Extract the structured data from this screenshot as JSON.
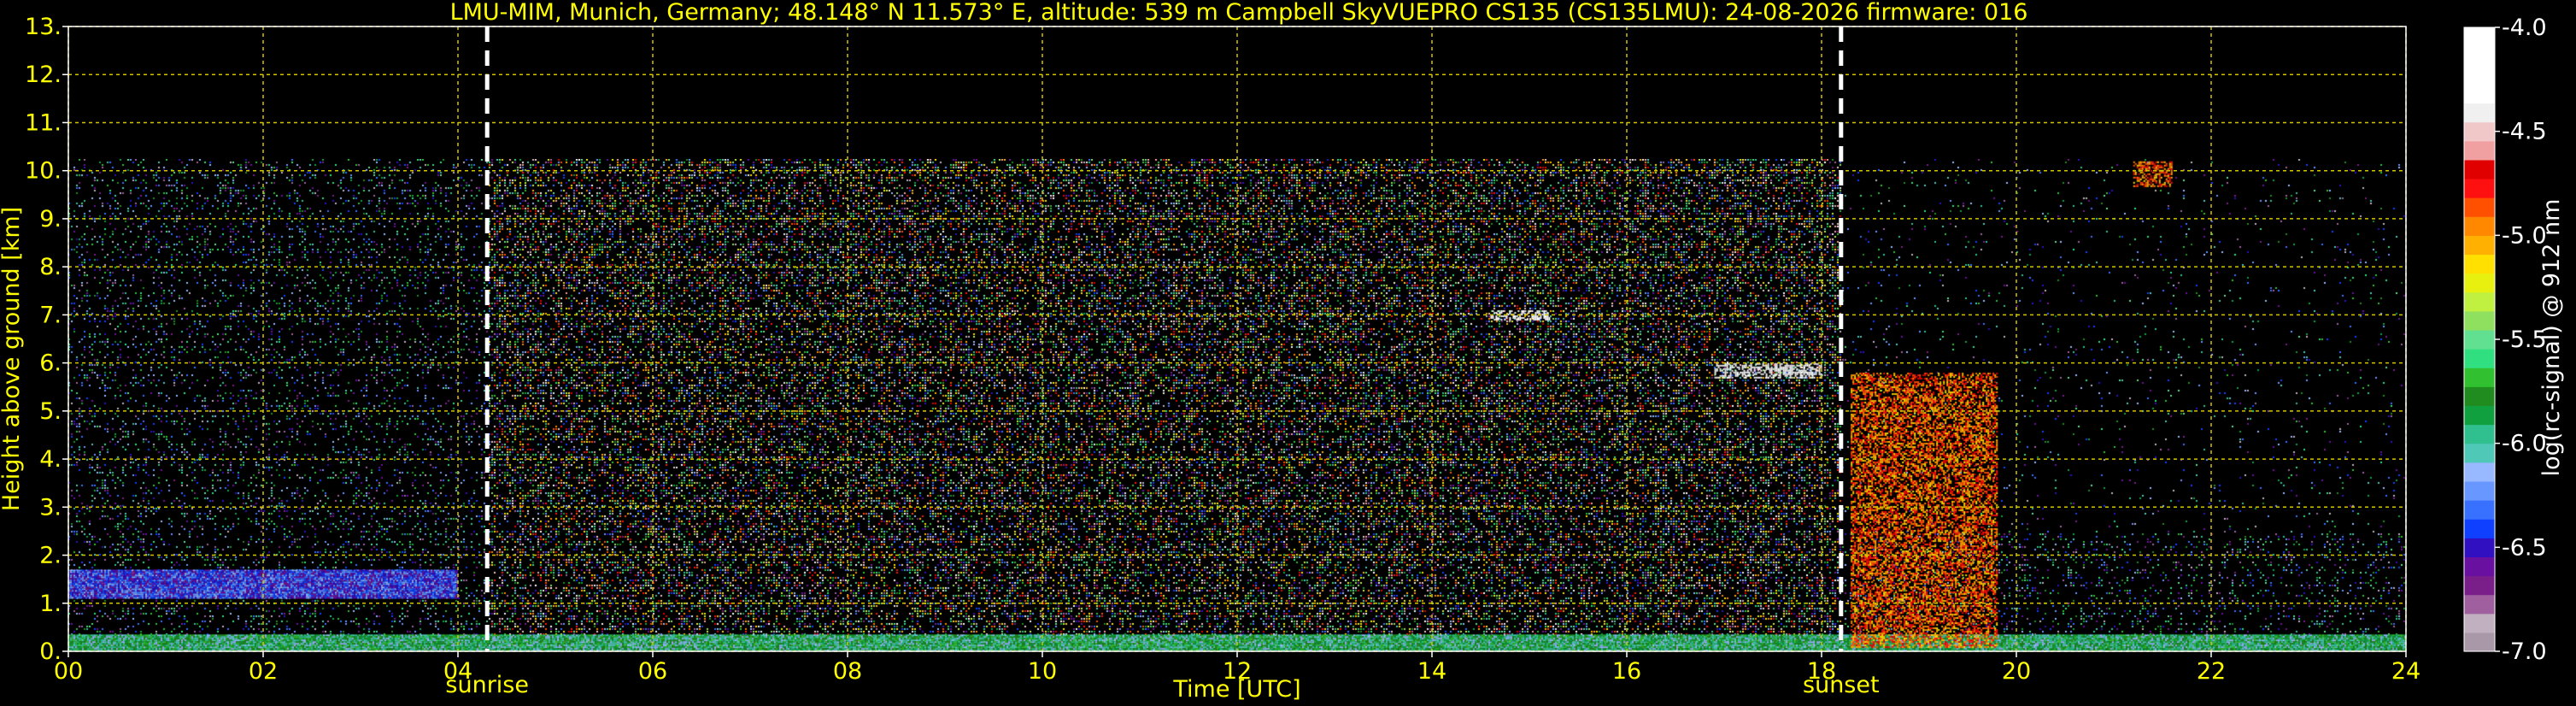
{
  "chart_data": {
    "type": "heatmap",
    "title": "LMU-MIM, Munich, Germany; 48.148° N 11.573° E, altitude: 539 m    Campbell SkyVUEPRO CS135 (CS135LMU): 24-08-2026    firmware: 016",
    "xlabel": "Time [UTC]",
    "ylabel": "Height above ground [km]",
    "xlim": [
      0,
      24
    ],
    "ylim": [
      0,
      13
    ],
    "x_ticks": [
      0,
      2,
      4,
      6,
      8,
      10,
      12,
      14,
      16,
      18,
      20,
      22,
      24
    ],
    "x_tick_labels": [
      "00",
      "02",
      "04",
      "06",
      "08",
      "10",
      "12",
      "14",
      "16",
      "18",
      "20",
      "22",
      "24"
    ],
    "y_ticks": [
      0,
      1,
      2,
      3,
      4,
      5,
      6,
      7,
      8,
      9,
      10,
      11,
      12,
      13
    ],
    "y_tick_labels": [
      "0.",
      "1.",
      "2.",
      "3.",
      "4.",
      "5.",
      "6.",
      "7.",
      "8.",
      "9.",
      "10.",
      "11.",
      "12.",
      "13."
    ],
    "grid": true,
    "data_top_km": 10.25,
    "events": [
      {
        "label": "sunrise",
        "time": 4.3
      },
      {
        "label": "sunset",
        "time": 18.2
      }
    ],
    "colorbar": {
      "label": "log(rc-signal) @ 912 nm",
      "range": [
        -7.0,
        -4.0
      ],
      "ticks": [
        -4.0,
        -4.5,
        -5.0,
        -5.5,
        -6.0,
        -6.5,
        -7.0
      ],
      "tick_labels": [
        "-4.0",
        "-4.5",
        "-5.0",
        "-5.5",
        "-6.0",
        "-6.5",
        "-7.0"
      ],
      "colors": [
        "#a898a8",
        "#c0b0c0",
        "#a060a0",
        "#7a1e8a",
        "#6a10a0",
        "#3010c0",
        "#1040ff",
        "#3870ff",
        "#6898ff",
        "#98b8ff",
        "#50c8b8",
        "#30c090",
        "#10a040",
        "#208c20",
        "#30c030",
        "#30e080",
        "#60e090",
        "#90e060",
        "#c0f040",
        "#e8f010",
        "#ffe000",
        "#ffb000",
        "#ff8800",
        "#ff5000",
        "#ff1010",
        "#e00000",
        "#f0a0a0",
        "#f0c8c8",
        "#f0f0f0",
        "#ffffff",
        "#ffffff",
        "#ffffff",
        "#ffffff"
      ]
    },
    "features": [
      {
        "kind": "aerosol_layer",
        "t0": 0,
        "t1": 4,
        "z0": 1.1,
        "z1": 1.7,
        "level": -6.4
      },
      {
        "kind": "boundary_layer",
        "t0": 0,
        "t1": 24,
        "z0": 0,
        "z1": 0.35,
        "level": -5.9
      },
      {
        "kind": "cloud",
        "t0": 14.6,
        "t1": 15.2,
        "z0": 6.9,
        "z1": 7.1,
        "level": -4.2
      },
      {
        "kind": "cloud",
        "t0": 16.9,
        "t1": 18.0,
        "z0": 5.7,
        "z1": 6.0,
        "level": -4.2
      },
      {
        "kind": "cloud",
        "t0": 18.3,
        "t1": 19.8,
        "z0": 0.1,
        "z1": 5.8,
        "level": -4.9
      },
      {
        "kind": "cloud",
        "t0": 21.2,
        "t1": 21.6,
        "z0": 9.7,
        "z1": 10.2,
        "level": -4.9
      }
    ]
  }
}
